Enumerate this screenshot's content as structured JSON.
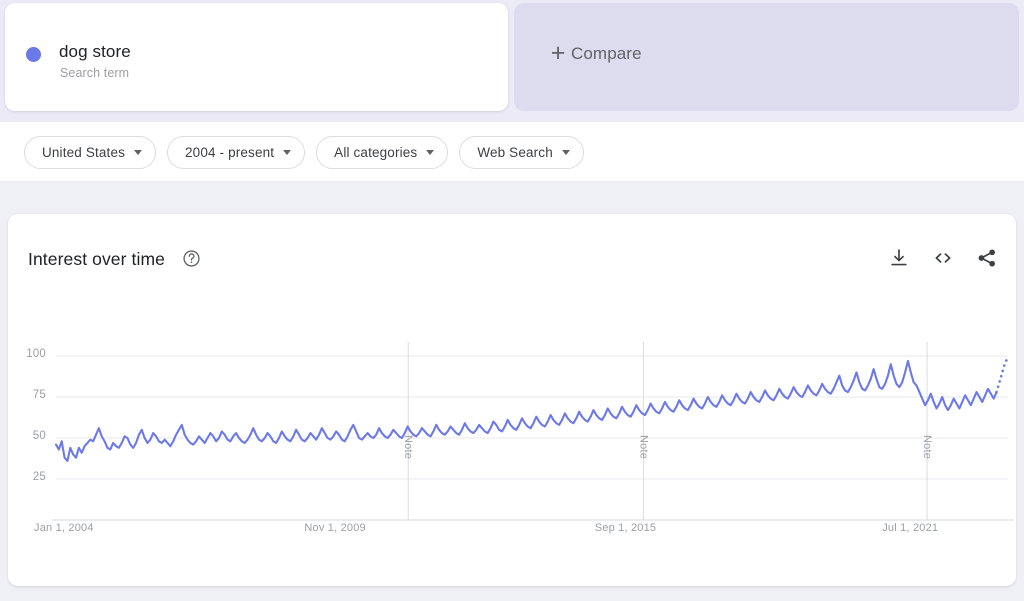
{
  "terms": [
    {
      "label": "dog store",
      "sublabel": "Search term",
      "color": "#6c79e8",
      "dot_name": "series-dot"
    }
  ],
  "compare": {
    "plus": "+",
    "label": "Compare"
  },
  "filters": [
    {
      "label": "United States"
    },
    {
      "label": "2004 - present"
    },
    {
      "label": "All categories"
    },
    {
      "label": "Web Search"
    }
  ],
  "chart_card": {
    "title": "Interest over time",
    "help_icon": "help-circle-icon",
    "actions": [
      {
        "name": "download-icon"
      },
      {
        "name": "embed-code-icon"
      },
      {
        "name": "share-icon"
      }
    ]
  },
  "chart_data": {
    "type": "line",
    "title": "Interest over time",
    "xlabel": "",
    "ylabel": "",
    "ylim": [
      0,
      100
    ],
    "yticks": [
      100,
      75,
      50,
      25
    ],
    "xticks": [
      "Jan 1, 2004",
      "Nov 1, 2009",
      "Sep 1, 2015",
      "Jul 1, 2021"
    ],
    "xtick_positions": [
      0.0,
      0.305,
      0.61,
      0.912
    ],
    "grid": true,
    "legend": "none",
    "series_color": "#6c79e8",
    "series_name": "dog store",
    "annotations": [
      {
        "label": "Note",
        "x_frac": 0.37
      },
      {
        "label": "Note",
        "x_frac": 0.617
      },
      {
        "label": "Note",
        "x_frac": 0.915
      }
    ],
    "partial_tail": true,
    "partial_tail_note": "Final segment drawn dotted (incomplete data)",
    "values": [
      46,
      43,
      48,
      38,
      36,
      44,
      40,
      38,
      44,
      41,
      45,
      47,
      49,
      48,
      52,
      56,
      51,
      48,
      44,
      43,
      47,
      45,
      44,
      47,
      51,
      50,
      46,
      44,
      47,
      52,
      55,
      50,
      47,
      49,
      53,
      51,
      48,
      47,
      49,
      47,
      45,
      48,
      52,
      55,
      58,
      52,
      49,
      47,
      46,
      48,
      51,
      49,
      47,
      50,
      53,
      51,
      48,
      50,
      54,
      52,
      49,
      48,
      51,
      53,
      50,
      48,
      47,
      49,
      52,
      56,
      52,
      49,
      48,
      50,
      53,
      51,
      48,
      47,
      50,
      54,
      51,
      49,
      48,
      51,
      55,
      52,
      49,
      48,
      50,
      53,
      51,
      49,
      52,
      56,
      53,
      50,
      49,
      51,
      54,
      52,
      49,
      48,
      51,
      55,
      58,
      54,
      50,
      49,
      51,
      53,
      51,
      50,
      52,
      56,
      53,
      51,
      50,
      52,
      55,
      53,
      51,
      50,
      53,
      57,
      54,
      52,
      51,
      53,
      56,
      54,
      52,
      51,
      54,
      58,
      55,
      53,
      52,
      54,
      57,
      55,
      53,
      52,
      55,
      59,
      56,
      54,
      53,
      55,
      58,
      56,
      54,
      53,
      56,
      60,
      58,
      55,
      54,
      57,
      61,
      58,
      56,
      55,
      58,
      62,
      59,
      57,
      56,
      59,
      63,
      60,
      58,
      57,
      60,
      64,
      61,
      59,
      58,
      61,
      65,
      62,
      60,
      59,
      62,
      66,
      63,
      61,
      60,
      63,
      67,
      64,
      62,
      61,
      64,
      68,
      65,
      63,
      62,
      65,
      69,
      66,
      64,
      63,
      66,
      70,
      67,
      65,
      64,
      67,
      71,
      68,
      66,
      65,
      68,
      72,
      69,
      67,
      66,
      69,
      73,
      70,
      68,
      67,
      70,
      74,
      71,
      69,
      68,
      71,
      75,
      72,
      70,
      69,
      72,
      76,
      73,
      71,
      70,
      73,
      77,
      74,
      72,
      71,
      74,
      78,
      75,
      73,
      72,
      75,
      79,
      76,
      74,
      73,
      76,
      80,
      77,
      75,
      74,
      77,
      81,
      78,
      76,
      75,
      78,
      82,
      79,
      77,
      76,
      79,
      83,
      80,
      78,
      77,
      80,
      84,
      88,
      82,
      79,
      78,
      81,
      85,
      90,
      84,
      80,
      79,
      82,
      86,
      92,
      86,
      81,
      80,
      83,
      88,
      95,
      88,
      83,
      81,
      84,
      90,
      97,
      90,
      84,
      82,
      78,
      74,
      70,
      73,
      77,
      72,
      68,
      71,
      75,
      70,
      67,
      70,
      74,
      71,
      68,
      72,
      76,
      73,
      70,
      74,
      78,
      75,
      72,
      76,
      80,
      77,
      74,
      78,
      84,
      90,
      96,
      99
    ]
  }
}
